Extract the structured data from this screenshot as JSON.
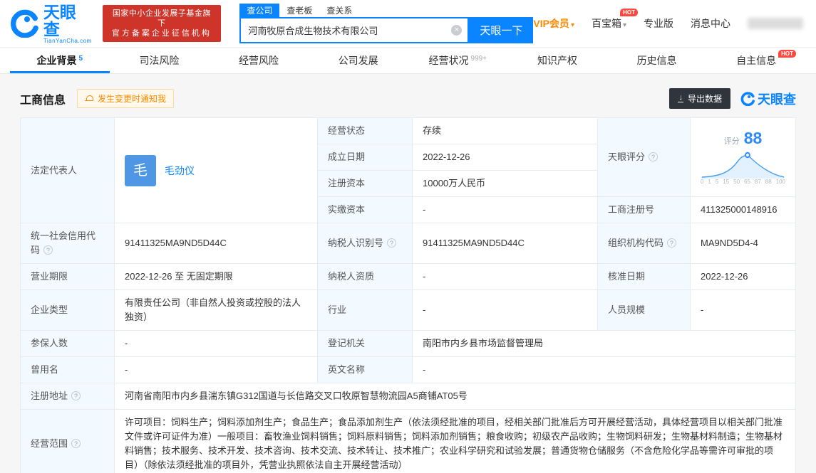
{
  "colors": {
    "brand_blue": "#0b84ff",
    "link_blue": "#0b84ff",
    "vip_orange": "#ff8a00",
    "badge_red": "#ce3429",
    "hot_red": "#ff4940",
    "label_bg": "#f2f9ff",
    "avatar_blue": "#4f96e5",
    "export_dark": "#30343d",
    "score_blue": "#2f8af5"
  },
  "icons": {
    "clear": "×",
    "caret": "▾",
    "download": "↓",
    "help": "?"
  },
  "header": {
    "logo": {
      "brand": "天眼查",
      "domain": "TianYanCha.com"
    },
    "badge": {
      "line1": "国家中小企业发展子基金旗下",
      "line2": "官方备案企业征信机构"
    },
    "search": {
      "tabs": [
        {
          "label": "查公司"
        },
        {
          "label": "查老板"
        },
        {
          "label": "查关系"
        }
      ],
      "value": "河南牧原合成生物技术有限公司",
      "button": "天眼一下"
    },
    "menu": {
      "vip": "VIP会员",
      "toolbox": "百宝箱",
      "pro": "专业版",
      "messages": "消息中心",
      "hot": "HOT"
    }
  },
  "nav": {
    "tabs": [
      {
        "label": "企业背景",
        "count": "5"
      },
      {
        "label": "司法风险"
      },
      {
        "label": "经营风险"
      },
      {
        "label": "公司发展"
      },
      {
        "label": "经营状况",
        "count": "999+"
      },
      {
        "label": "知识产权"
      },
      {
        "label": "历史信息"
      },
      {
        "label": "自主信息",
        "hot": "HOT"
      }
    ]
  },
  "section": {
    "title": "工商信息",
    "notify": "发生变更时通知我",
    "export": "导出数据",
    "watermark": "天眼查"
  },
  "table": {
    "legal_rep": {
      "label": "法定代表人",
      "avatar": "毛",
      "name": "毛劲仪"
    },
    "status": {
      "label": "经营状态",
      "value": "存续"
    },
    "est_date": {
      "label": "成立日期",
      "value": "2022-12-26"
    },
    "reg_capital": {
      "label": "注册资本",
      "value": "10000万人民币"
    },
    "paid_capital": {
      "label": "实缴资本",
      "value": "-"
    },
    "score": {
      "label": "天眼评分",
      "caption": "评分",
      "value": "88",
      "axis": [
        "0",
        "1",
        "5",
        "15",
        "50",
        "65",
        "87",
        "88",
        "100"
      ]
    },
    "reg_number": {
      "label": "工商注册号",
      "value": "411325000148916"
    },
    "credit_code": {
      "label": "统一社会信用代码",
      "value": "91411325MA9ND5D44C"
    },
    "taxpayer_id": {
      "label": "纳税人识别号",
      "value": "91411325MA9ND5D44C"
    },
    "org_code": {
      "label": "组织机构代码",
      "value": "MA9ND5D4-4"
    },
    "business_term": {
      "label": "营业期限",
      "value": "2022-12-26 至 无固定期限"
    },
    "taxpayer_quality": {
      "label": "纳税人资质",
      "value": "-"
    },
    "approval_date": {
      "label": "核准日期",
      "value": "2022-12-26"
    },
    "company_type": {
      "label": "企业类型",
      "value": "有限责任公司（非自然人投资或控股的法人独资）"
    },
    "industry": {
      "label": "行业",
      "value": "-"
    },
    "staff_size": {
      "label": "人员规模",
      "value": "-"
    },
    "insured_count": {
      "label": "参保人数",
      "value": "-"
    },
    "registry_authority": {
      "label": "登记机关",
      "value": "南阳市内乡县市场监督管理局"
    },
    "former_name": {
      "label": "曾用名",
      "value": "-"
    },
    "english_name": {
      "label": "英文名称",
      "value": "-"
    },
    "address": {
      "label": "注册地址",
      "value": "河南省南阳市内乡县湍东镇G312国道与长信路交叉口牧原智慧物流园A5商铺AT05号"
    },
    "business_scope": {
      "label": "经营范围",
      "value": "许可项目：饲料生产；饲料添加剂生产；食品生产；食品添加剂生产（依法须经批准的项目，经相关部门批准后方可开展经营活动，具体经营项目以相关部门批准文件或许可证件为准）一般项目：畜牧渔业饲料销售；饲料原料销售；饲料添加剂销售；粮食收购；初级农产品收购；生物饲料研发；生物基材料制造；生物基材料销售；技术服务、技术开发、技术咨询、技术交流、技术转让、技术推广；农业科学研究和试验发展；普通货物仓储服务（不含危险化学品等需许可审批的项目）（除依法须经批准的项目外，凭营业执照依法自主开展经营活动）"
    }
  }
}
